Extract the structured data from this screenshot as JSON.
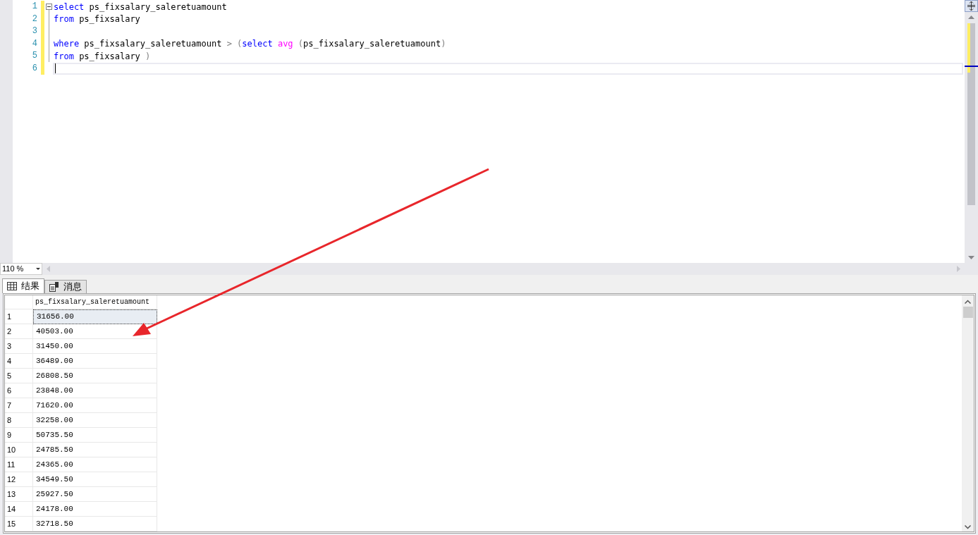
{
  "editor": {
    "lines": [
      {
        "number": "1",
        "current": false,
        "segments": [
          {
            "text": "select",
            "kind": "keyword"
          },
          {
            "text": " ps_fixsalary_saleretuamount",
            "kind": "plain"
          }
        ]
      },
      {
        "number": "2",
        "current": false,
        "segments": [
          {
            "text": "from",
            "kind": "keyword"
          },
          {
            "text": " ps_fixsalary",
            "kind": "plain"
          }
        ]
      },
      {
        "number": "3",
        "current": false
      },
      {
        "number": "4",
        "current": false,
        "segments": [
          {
            "text": "where",
            "kind": "keyword"
          },
          {
            "text": " ps_fixsalary_saleretuamount ",
            "kind": "plain"
          },
          {
            "text": ">",
            "kind": "operator"
          },
          {
            "text": " (",
            "kind": "operator"
          },
          {
            "text": "select ",
            "kind": "keyword"
          },
          {
            "text": "avg",
            "kind": "function"
          },
          {
            "text": " (",
            "kind": "operator"
          },
          {
            "text": "ps_fixsalary_saleretuamount",
            "kind": "plain"
          },
          {
            "text": ")",
            "kind": "operator"
          }
        ]
      },
      {
        "number": "5",
        "current": false,
        "segments": [
          {
            "text": "from",
            "kind": "keyword"
          },
          {
            "text": " ps_fixsalary ",
            "kind": "plain"
          },
          {
            "text": ")",
            "kind": "operator"
          }
        ]
      },
      {
        "number": "6",
        "current": true
      }
    ]
  },
  "zoom": {
    "value": "110 %"
  },
  "tabs": [
    {
      "label": "结果",
      "selected": true,
      "kind": "grid"
    },
    {
      "label": "消息",
      "selected": false,
      "kind": "messages"
    }
  ],
  "results": {
    "columns": [
      "ps_fixsalary_saleretuamount"
    ],
    "rows": [
      {
        "number": "1",
        "cells": [
          "31656.00"
        ],
        "selected": true
      },
      {
        "number": "2",
        "cells": [
          "40503.00"
        ],
        "selected": false
      },
      {
        "number": "3",
        "cells": [
          "31450.00"
        ],
        "selected": false
      },
      {
        "number": "4",
        "cells": [
          "36489.00"
        ],
        "selected": false
      },
      {
        "number": "5",
        "cells": [
          "26808.50"
        ],
        "selected": false
      },
      {
        "number": "6",
        "cells": [
          "23848.00"
        ],
        "selected": false
      },
      {
        "number": "7",
        "cells": [
          "71620.00"
        ],
        "selected": false
      },
      {
        "number": "8",
        "cells": [
          "32258.00"
        ],
        "selected": false
      },
      {
        "number": "9",
        "cells": [
          "50735.50"
        ],
        "selected": false
      },
      {
        "number": "10",
        "cells": [
          "24785.50"
        ],
        "selected": false
      },
      {
        "number": "11",
        "cells": [
          "24365.00"
        ],
        "selected": false
      },
      {
        "number": "12",
        "cells": [
          "34549.50"
        ],
        "selected": false
      },
      {
        "number": "13",
        "cells": [
          "25927.50"
        ],
        "selected": false
      },
      {
        "number": "14",
        "cells": [
          "24178.00"
        ],
        "selected": false
      },
      {
        "number": "15",
        "cells": [
          "32718.50"
        ],
        "selected": false
      }
    ]
  }
}
